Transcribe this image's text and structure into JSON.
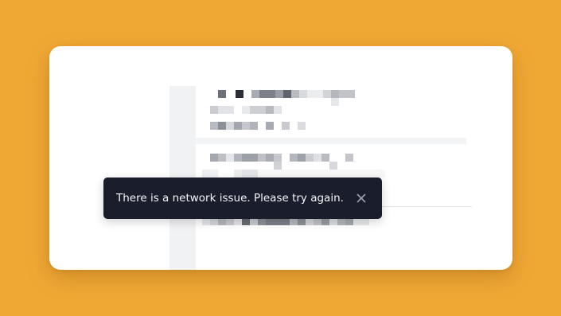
{
  "toast": {
    "message": "There is a network issue. Please try again.",
    "close_icon": "close-icon"
  },
  "colors": {
    "page_background": "#F0A835",
    "card_background": "#FFFFFF",
    "toast_background": "#1A1E2C",
    "toast_text": "#F4F5F7",
    "close_icon": "#9CA3AF"
  }
}
